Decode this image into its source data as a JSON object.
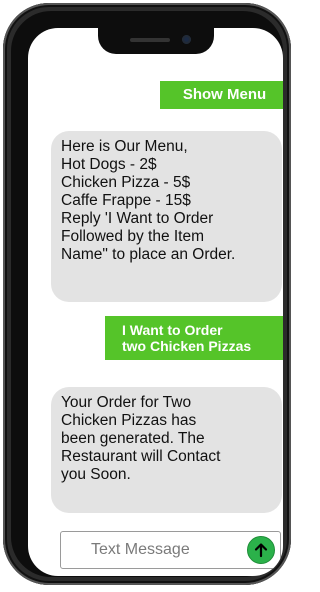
{
  "colors": {
    "accent_green": "#55c429",
    "bubble_gray": "#e3e3e3",
    "send_green": "#2bb14a"
  },
  "chat": {
    "show_menu_label": "Show Menu",
    "menu_message": "Here is Our Menu,\nHot Dogs - 2$\nChicken Pizza - 5$\nCaffe Frappe - 15$\nReply 'I Want to Order\nFollowed by the Item\nName\" to place an Order.",
    "order_message": "I Want to Order\ntwo Chicken Pizzas",
    "reply_message": "Your Order for Two\nChicken Pizzas has\nbeen generated. The\nRestaurant will Contact\nyou Soon."
  },
  "composer": {
    "placeholder": "Text Message",
    "value": "",
    "send_icon": "arrow-up-icon"
  }
}
